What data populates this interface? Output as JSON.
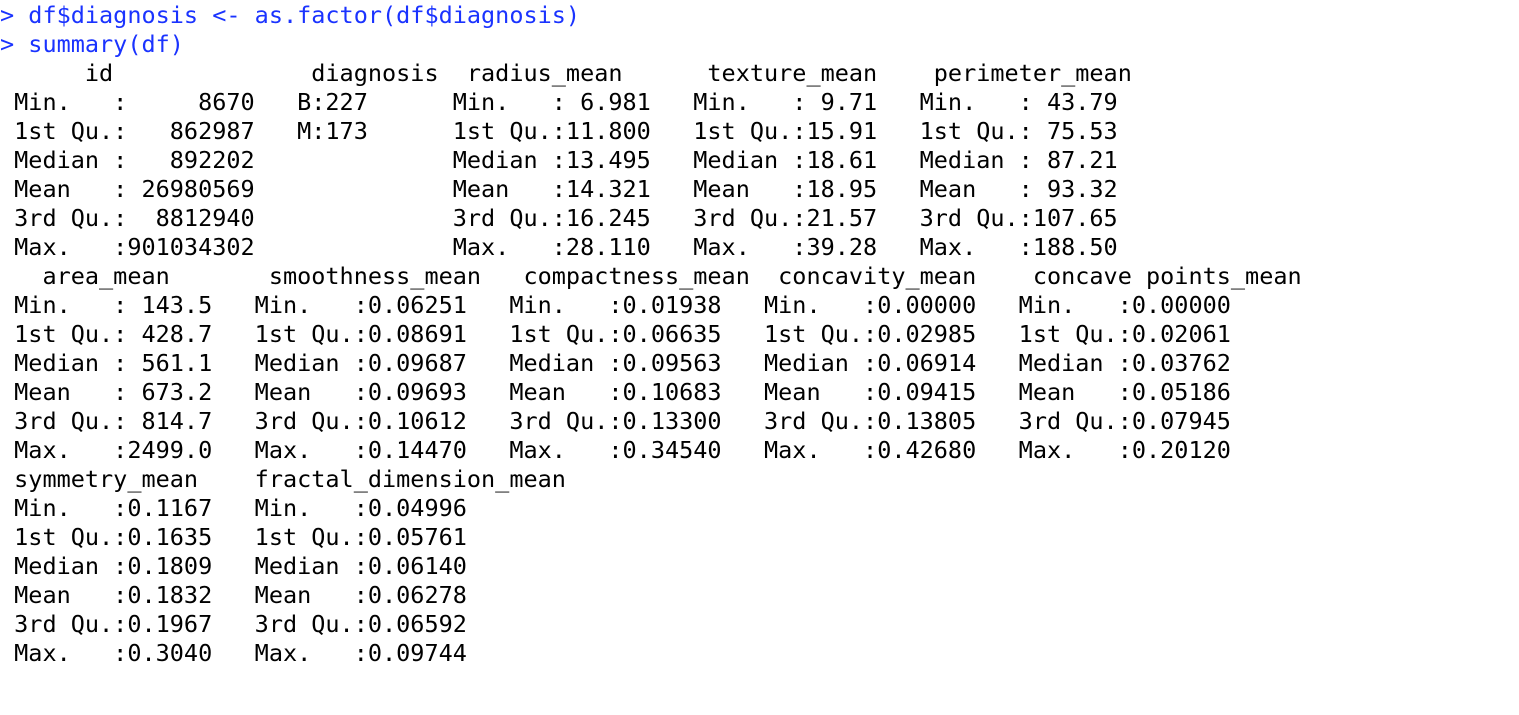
{
  "console": {
    "commands": [
      {
        "prompt": "> ",
        "text": "df$diagnosis <- as.factor(df$diagnosis)"
      },
      {
        "prompt": "> ",
        "text": "summary(df)"
      }
    ],
    "output": [
      "      id              diagnosis  radius_mean      texture_mean    perimeter_mean  ",
      " Min.   :     8670   B:227      Min.   : 6.981   Min.   : 9.71   Min.   : 43.79  ",
      " 1st Qu.:   862987   M:173      1st Qu.:11.800   1st Qu.:15.91   1st Qu.: 75.53  ",
      " Median :   892202              Median :13.495   Median :18.61   Median : 87.21  ",
      " Mean   : 26980569              Mean   :14.321   Mean   :18.95   Mean   : 93.32  ",
      " 3rd Qu.:  8812940              3rd Qu.:16.245   3rd Qu.:21.57   3rd Qu.:107.65  ",
      " Max.   :901034302              Max.   :28.110   Max.   :39.28   Max.   :188.50  ",
      "   area_mean       smoothness_mean   compactness_mean  concavity_mean    concave points_mean",
      " Min.   : 143.5   Min.   :0.06251   Min.   :0.01938   Min.   :0.00000   Min.   :0.00000   ",
      " 1st Qu.: 428.7   1st Qu.:0.08691   1st Qu.:0.06635   1st Qu.:0.02985   1st Qu.:0.02061   ",
      " Median : 561.1   Median :0.09687   Median :0.09563   Median :0.06914   Median :0.03762   ",
      " Mean   : 673.2   Mean   :0.09693   Mean   :0.10683   Mean   :0.09415   Mean   :0.05186   ",
      " 3rd Qu.: 814.7   3rd Qu.:0.10612   3rd Qu.:0.13300   3rd Qu.:0.13805   3rd Qu.:0.07945   ",
      " Max.   :2499.0   Max.   :0.14470   Max.   :0.34540   Max.   :0.42680   Max.   :0.20120   ",
      " symmetry_mean    fractal_dimension_mean",
      " Min.   :0.1167   Min.   :0.04996       ",
      " 1st Qu.:0.1635   1st Qu.:0.05761       ",
      " Median :0.1809   Median :0.06140       ",
      " Mean   :0.1832   Mean   :0.06278       ",
      " 3rd Qu.:0.1967   3rd Qu.:0.06592       ",
      " Max.   :0.3040   Max.   :0.09744       "
    ]
  }
}
